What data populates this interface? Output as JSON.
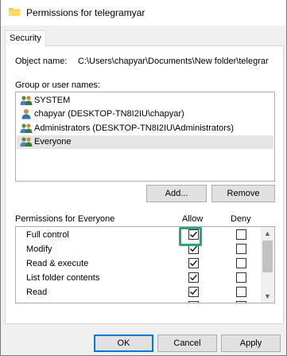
{
  "window": {
    "title": "Permissions for telegramyar"
  },
  "tabs": [
    {
      "label": "Security"
    }
  ],
  "object": {
    "label": "Object name:",
    "value": "C:\\Users\\chapyar\\Documents\\New folder\\telegrar"
  },
  "users": {
    "label": "Group or user names:",
    "items": [
      {
        "label": "SYSTEM",
        "icon": "user-group-icon",
        "selected": false
      },
      {
        "label": "chapyar (DESKTOP-TN8I2IU\\chapyar)",
        "icon": "user-icon",
        "selected": false
      },
      {
        "label": "Administrators (DESKTOP-TN8I2IU\\Administrators)",
        "icon": "user-group-icon",
        "selected": false
      },
      {
        "label": "Everyone",
        "icon": "user-group-icon",
        "selected": true
      }
    ],
    "add_label": "Add...",
    "remove_label": "Remove"
  },
  "permissions": {
    "label": "Permissions for Everyone",
    "allow_label": "Allow",
    "deny_label": "Deny",
    "rows": [
      {
        "name": "Full control",
        "allow": true,
        "deny": false
      },
      {
        "name": "Modify",
        "allow": true,
        "deny": false
      },
      {
        "name": "Read & execute",
        "allow": true,
        "deny": false
      },
      {
        "name": "List folder contents",
        "allow": true,
        "deny": false
      },
      {
        "name": "Read",
        "allow": true,
        "deny": false
      },
      {
        "name": "",
        "allow": true,
        "deny": false
      }
    ],
    "highlight_color": "#2aa57d"
  },
  "footer": {
    "ok_label": "OK",
    "cancel_label": "Cancel",
    "apply_label": "Apply"
  }
}
